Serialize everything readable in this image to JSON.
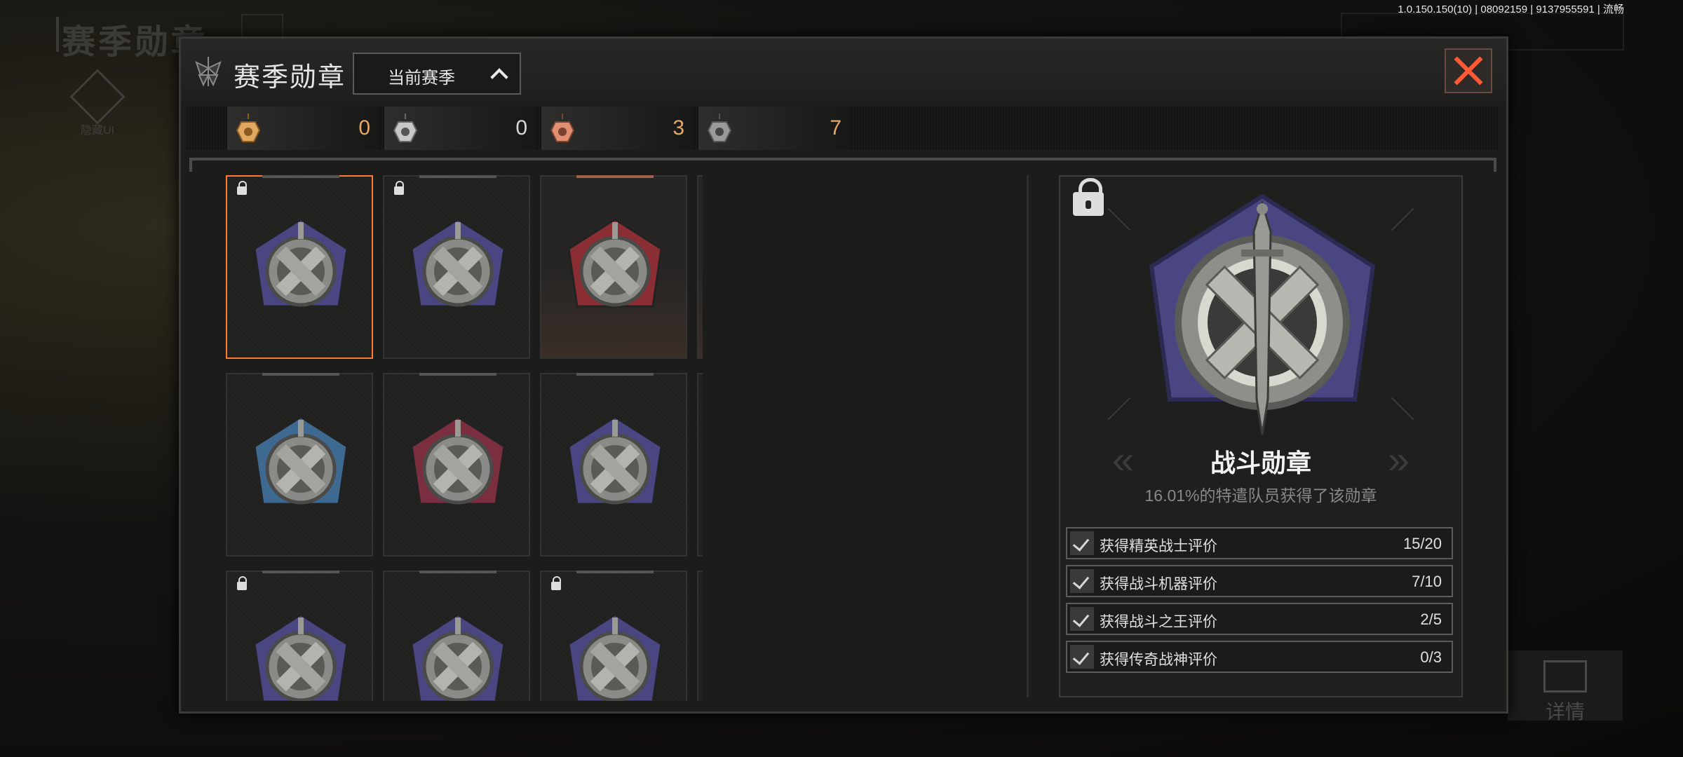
{
  "background": {
    "title": "赛季勋章",
    "hide_label": "隐藏UI",
    "details_label": "详情",
    "version": "1.0.150.150(10) | 08092159 | 9137955591 | 流畅"
  },
  "header": {
    "logo_icon": "wings-emblem-icon",
    "title": "赛季勋章",
    "season_select": {
      "label": "当前赛季",
      "icon": "chevron-up-icon"
    },
    "close_icon": "close-icon"
  },
  "medal_counts": [
    {
      "tier": "gold",
      "color": "#e0a860",
      "value": "0"
    },
    {
      "tier": "silver",
      "color": "#c8c8c8",
      "value": "0"
    },
    {
      "tier": "bronze",
      "color": "#e09070",
      "value": "3"
    },
    {
      "tier": "grey",
      "color": "#9a9a9a",
      "value": "7"
    }
  ],
  "medals": [
    {
      "name": "战斗勋章",
      "locked": true,
      "selected": true,
      "bg": "#4a4682",
      "frame": "plain"
    },
    {
      "name": "",
      "locked": true,
      "bg": "#4a4682",
      "frame": "plain"
    },
    {
      "name": "",
      "locked": false,
      "bg": "#8a2e34",
      "frame": "bronze"
    },
    {
      "name": "",
      "locked": false,
      "bg": "#4a3a7a",
      "frame": "bronze"
    },
    {
      "name": "",
      "locked": false,
      "bg": "#3e6a92",
      "frame": "plain"
    },
    {
      "name": "",
      "locked": false,
      "bg": "#3e6a92",
      "frame": "plain"
    },
    {
      "name": "",
      "locked": false,
      "bg": "#7a2e40",
      "frame": "plain"
    },
    {
      "name": "",
      "locked": false,
      "bg": "#4a4682",
      "frame": "plain"
    },
    {
      "name": "",
      "locked": false,
      "bg": "#3e4e38",
      "frame": "plain"
    },
    {
      "name": "",
      "locked": false,
      "bg": "#3e4e38",
      "frame": "bronze"
    },
    {
      "name": "",
      "locked": true,
      "bg": "#4a4682",
      "frame": "plain"
    },
    {
      "name": "",
      "locked": false,
      "bg": "#4a4682",
      "frame": "plain"
    },
    {
      "name": "",
      "locked": true,
      "bg": "#4a4682",
      "frame": "plain"
    },
    {
      "name": "",
      "locked": false,
      "bg": "#3e6a92",
      "frame": "plain"
    }
  ],
  "detail": {
    "name": "战斗勋章",
    "rate": "16.01%的特遣队员获得了该勋章",
    "locked": true,
    "requirements": [
      {
        "text": "获得精英战士评价",
        "progress": "15/20"
      },
      {
        "text": "获得战斗机器评价",
        "progress": "7/10"
      },
      {
        "text": "获得战斗之王评价",
        "progress": "2/5"
      },
      {
        "text": "获得传奇战神评价",
        "progress": "0/3"
      }
    ]
  }
}
